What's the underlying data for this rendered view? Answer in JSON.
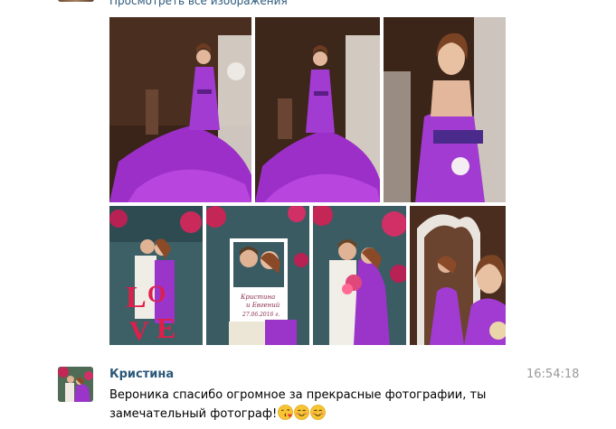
{
  "links": {
    "view_all_images": "Просмотреть все изображения"
  },
  "photos": [
    {
      "name": "photo-1",
      "description_icon": "bride-purple-gown-photo"
    },
    {
      "name": "photo-2",
      "description_icon": "bride-purple-gown-photo"
    },
    {
      "name": "photo-3",
      "description_icon": "bride-closeup-photo"
    },
    {
      "name": "photo-4",
      "description_icon": "couple-love-letters-photo"
    },
    {
      "name": "photo-5",
      "description_icon": "couple-frame-photo"
    },
    {
      "name": "photo-6",
      "description_icon": "couple-flowers-photo"
    },
    {
      "name": "photo-7",
      "description_icon": "bride-mirror-photo"
    }
  ],
  "message": {
    "author": "Кристина",
    "time": "16:54:18",
    "text": "Вероника спасибо огромное за прекрасные фотографии, ты замечательный фотограф!",
    "emojis": [
      "kiss-emoji",
      "smile-emoji",
      "smile-emoji"
    ]
  },
  "colors": {
    "link": "#2b587a",
    "time": "#999999",
    "gown": "#a23bd1"
  }
}
